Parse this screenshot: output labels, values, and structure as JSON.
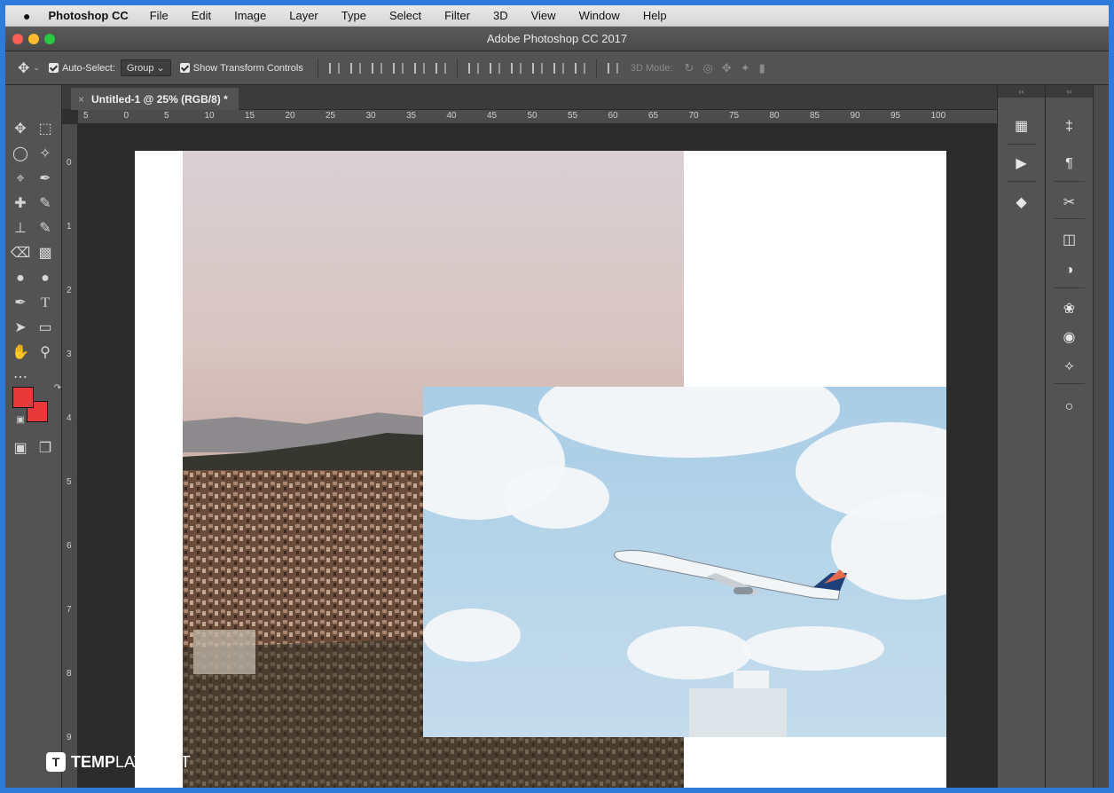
{
  "menubar": {
    "app_name": "Photoshop CC",
    "items": [
      "File",
      "Edit",
      "Image",
      "Layer",
      "Type",
      "Select",
      "Filter",
      "3D",
      "View",
      "Window",
      "Help"
    ]
  },
  "window": {
    "title": "Adobe Photoshop CC 2017"
  },
  "options": {
    "auto_select_label": "Auto-Select:",
    "auto_select_value": "Group",
    "show_transform_label": "Show Transform Controls",
    "mode_label": "3D Mode:"
  },
  "document": {
    "tab_label": "Untitled-1 @ 25% (RGB/8) *"
  },
  "rulers": {
    "horizontal": [
      "5",
      "0",
      "5",
      "10",
      "15",
      "20",
      "25",
      "30",
      "35",
      "40",
      "45",
      "50",
      "55",
      "60",
      "65",
      "70",
      "75",
      "80",
      "85",
      "90",
      "95",
      "100"
    ],
    "vertical": [
      "0",
      "1",
      "2",
      "3",
      "4",
      "5",
      "6",
      "7",
      "8",
      "9"
    ]
  },
  "colors": {
    "foreground": "#e8393b",
    "background": "#e8393b",
    "accent": "#2e7bd9"
  },
  "watermark": {
    "brand_bold": "TEMP",
    "brand_rest": "LATE.NET"
  }
}
